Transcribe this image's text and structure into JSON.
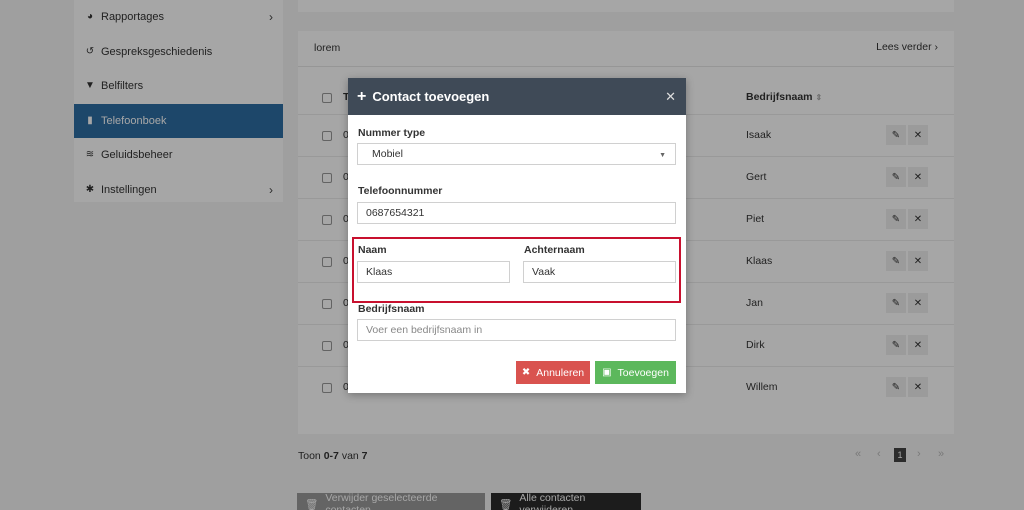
{
  "sidebar": {
    "items": [
      {
        "label": "Rapportages",
        "icon": "pie-chart-icon",
        "has_chevron": true
      },
      {
        "label": "Gespreksgeschiedenis",
        "icon": "history-icon",
        "has_chevron": false
      },
      {
        "label": "Belfilters",
        "icon": "filter-icon",
        "has_chevron": false
      },
      {
        "label": "Telefoonboek",
        "icon": "address-book-icon",
        "has_chevron": false,
        "active": true
      },
      {
        "label": "Geluidsbeheer",
        "icon": "waveform-icon",
        "has_chevron": false
      },
      {
        "label": "Instellingen",
        "icon": "gear-icon",
        "has_chevron": true
      }
    ]
  },
  "card": {
    "title": "lorem",
    "read_more": "Lees verder"
  },
  "table": {
    "first_header": "T",
    "company_header": "Bedrijfsnaam",
    "rows": [
      {
        "num": "0",
        "company": "Isaak"
      },
      {
        "num": "0",
        "company": "Gert"
      },
      {
        "num": "0",
        "company": "Piet"
      },
      {
        "num": "0",
        "company": "Klaas"
      },
      {
        "num": "0",
        "company": "Jan"
      },
      {
        "num": "0",
        "company": "Dirk"
      },
      {
        "num": "0",
        "company": "Willem"
      }
    ]
  },
  "footer": {
    "toon": "Toon",
    "range": "0-7",
    "van": "van",
    "total": "7",
    "current_page": "1",
    "delete_selected": "Verwijder geselecteerde contacten",
    "delete_all": "Alle contacten verwijderen"
  },
  "modal": {
    "title": "Contact toevoegen",
    "number_type_label": "Nummer type",
    "number_type_value": "Mobiel",
    "phone_label": "Telefoonnummer",
    "phone_value": "0687654321",
    "first_name_label": "Naam",
    "first_name_value": "Klaas",
    "last_name_label": "Achternaam",
    "last_name_value": "Vaak",
    "company_label": "Bedrijfsnaam",
    "company_placeholder": "Voer een bedrijfsnaam in",
    "cancel_label": "Annuleren",
    "add_label": "Toevoegen"
  },
  "colors": {
    "active_nav": "#2d6da3",
    "modal_header": "#3f4a57",
    "cancel_button": "#d9534f",
    "add_button": "#5cb85c",
    "highlight": "#c8102e"
  }
}
